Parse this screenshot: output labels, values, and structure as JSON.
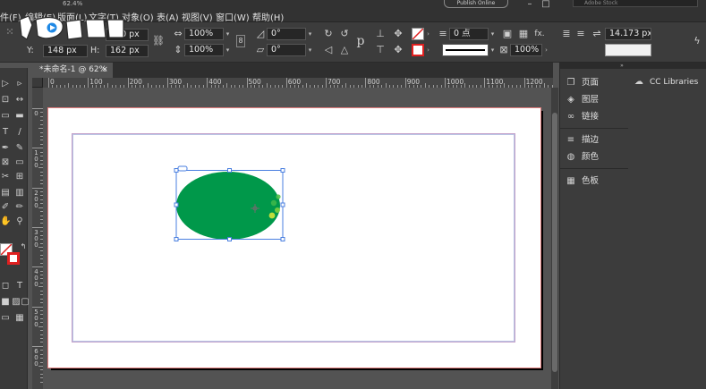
{
  "menubar": {
    "items": [
      "件(F)",
      "编辑(E)",
      "版面(L)",
      "文字(T)",
      "对象(O)",
      "表(A)",
      "视图(V)",
      "窗口(W)",
      "帮助(H)"
    ],
    "zoom": "62.4%",
    "publish_label": "Publish Online",
    "stock_placeholder": "Adobe Stock"
  },
  "controlbar": {
    "x_value": "220 px",
    "y_label": "Y:",
    "y_value": "148 px",
    "h_label": "H:",
    "h_value": "162 px",
    "scale_x": "100%",
    "scale_y": "100%",
    "rotate": "0°",
    "shear": "0°",
    "stroke_weight": "0 点",
    "opacity": "100%",
    "fx_label": "fx.",
    "width_value": "14.173 px"
  },
  "tab": {
    "title": "*未命名-1 @ 62%",
    "close": "×"
  },
  "ruler_h": [
    "0",
    "100",
    "200",
    "300",
    "400",
    "500",
    "600",
    "700",
    "800",
    "900",
    "1000",
    "1100",
    "1200"
  ],
  "ruler_v": [
    "0",
    "100",
    "200",
    "300",
    "400",
    "500",
    "600"
  ],
  "panel_a": {
    "items": [
      "页面",
      "图层",
      "链接",
      "描边",
      "颜色",
      "色板"
    ]
  },
  "panel_b": {
    "cc_libraries": "CC Libraries"
  },
  "colors": {
    "ellipse_fill": "#00984a",
    "selection": "#4a7fe0",
    "page_bleed": "#e07a7a"
  },
  "icons": [
    "collapse-icon",
    "lightning-icon"
  ]
}
